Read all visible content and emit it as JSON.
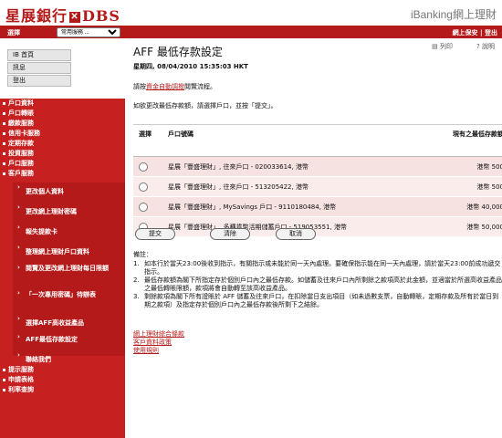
{
  "header": {
    "bank_name": "星展銀行",
    "dbs_mark": "✕",
    "dbs_text": "DBS",
    "product_title": "iBanking網上理財"
  },
  "topbar": {
    "select_label": "選擇",
    "service_select_value": "常用服務 ...",
    "right_links": "網上保安 | 登出"
  },
  "quick_links": [
    "IB 首頁",
    "訊息",
    "登出"
  ],
  "menu": {
    "top_items": [
      "戶口資料",
      "戶口轉賬",
      "繳款服務",
      "信用卡服務",
      "定期存款",
      "投資服務",
      "戶口服務",
      "客戶服務"
    ],
    "sub_items": [
      "更改個人資料",
      "更改網上理財密碼",
      "報失提款卡",
      "整理網上理財戶口資料",
      "閱覽及更改網上理財每日限額",
      "「一次專用密碼」待辦表",
      "選擇AFF高收益產品",
      "AFF最低存款設定",
      "聯絡我們"
    ],
    "bottom_items": [
      "提示服務",
      "申請表格",
      "利率查詢"
    ]
  },
  "page": {
    "title": "AFF 最低存款設定",
    "print_label": "列印",
    "help_label": "說明",
    "datetime": "星期四, 08/04/2010 15:35:03 HKT",
    "intro_prefix": "請按",
    "intro_link": "資金自動調撥",
    "intro_suffix": "閱覽流程。",
    "instruction": "如欲更改最低存款額，請選擇戶口，並按「提交」。"
  },
  "table": {
    "headers": [
      "選擇",
      "戶口號碼",
      "現有之最低存款額"
    ],
    "rows": [
      {
        "account": "星展「豐盛理財」, 往來戶口 - 020033614, 港幣",
        "amount": "港幣 500"
      },
      {
        "account": "星展「豐盛理財」, 往來戶口 - 513205422, 港幣",
        "amount": "港幣 500"
      },
      {
        "account": "星展「豐盛理財」, MySavings 戶口 - 9110180484, 港幣",
        "amount": "港幣 40,000"
      },
      {
        "account": "星展「豐盛理財」, 多種貨幣活期儲蓄戶口 - 519053551, 港幣",
        "amount": "港幣 50,000"
      }
    ]
  },
  "buttons": {
    "submit": "提交",
    "clear": "清除",
    "cancel": "取消"
  },
  "notes": {
    "heading": "備註：",
    "items": [
      {
        "num": "1.",
        "text": "如本行於當天23:00後收到指示，有關指示或未能於同一天內處理。要確保指示能在同一天內處理，請於當天23:00前成功遞交指示。"
      },
      {
        "num": "2.",
        "text": "最低存款額為閣下所指定存於個別戶口內之最低存款。如儲蓄及往來戶口內所剩餘之款項高於此金額，並適當於所選高收益產品之最低轉賬限額，款項將會自動轉至該高收益產品。"
      },
      {
        "num": "3.",
        "text": "剩餘款項為閣下所有證賬於 AFF 儲蓄及往來戶口，在扣除當日支出項目（如未過數支票，自動轉賬，定期存款及所有於當日到期之款項）及指定存於個別戶口內之最低存款後所剩下之結餘。"
      }
    ]
  },
  "footer_links": [
    "網上理財綜合條款",
    "客戶資料政策",
    "使用規則"
  ]
}
